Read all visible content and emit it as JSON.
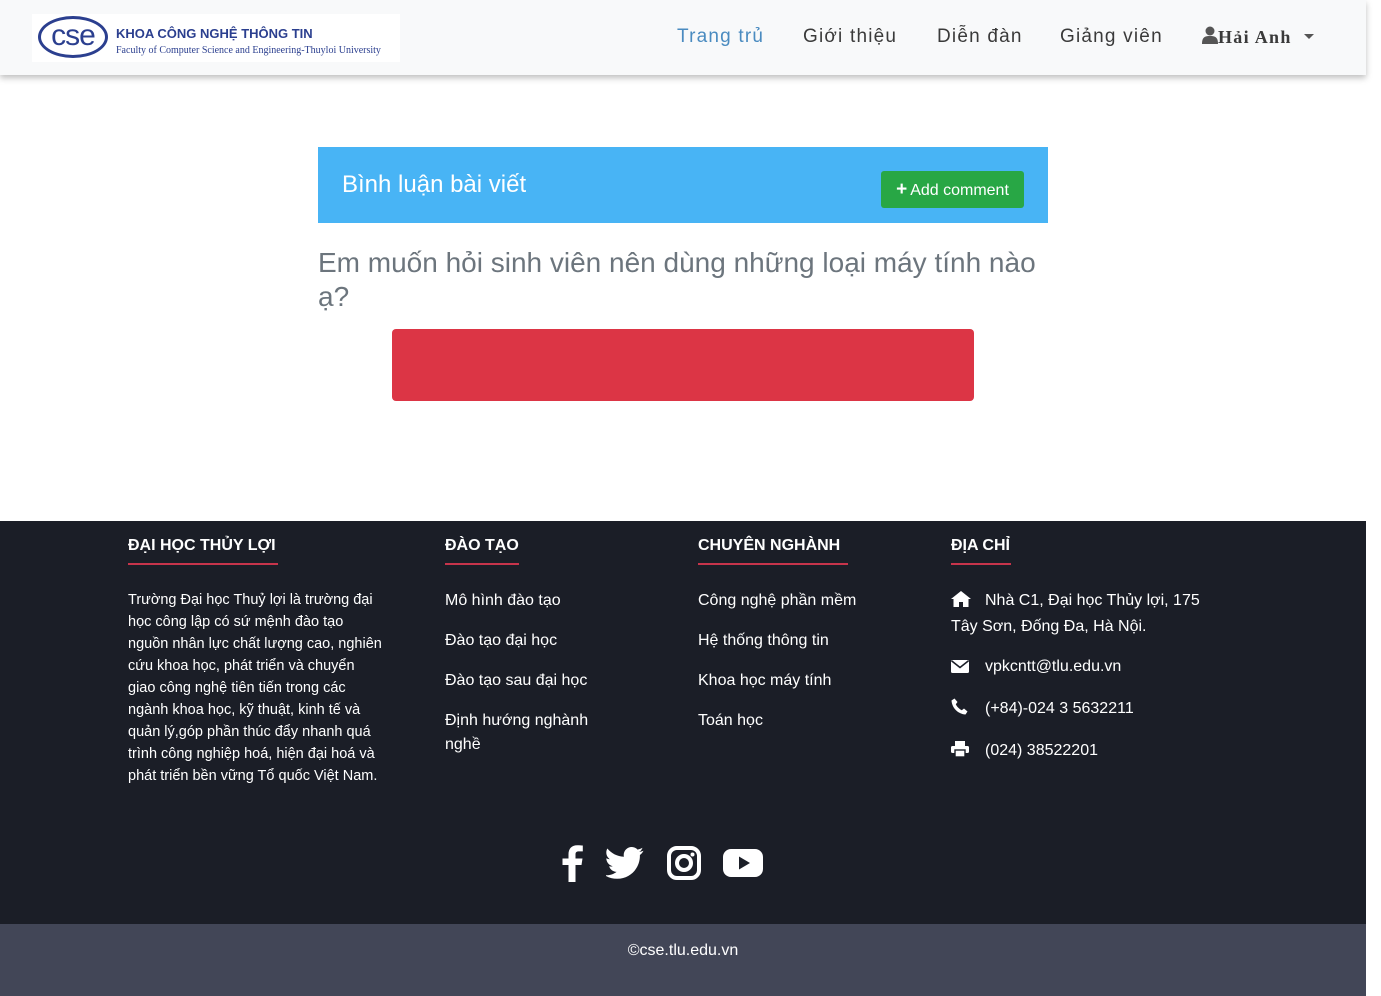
{
  "brand": {
    "logo_mark": "cse",
    "title": "KHOA CÔNG NGHỆ THÔNG TIN",
    "subtitle": "Faculty of Computer Science and Engineering-Thuyloi University"
  },
  "nav": {
    "items": [
      {
        "label": "Trang trủ",
        "active": true
      },
      {
        "label": "Giới thiệu",
        "active": false
      },
      {
        "label": "Diễn đàn",
        "active": false
      },
      {
        "label": "Giảng viên",
        "active": false
      }
    ],
    "user": {
      "name": "Hải Anh",
      "icon": "user-icon"
    }
  },
  "comments": {
    "header_title": "Bình luận bài viết",
    "add_button_label": "Add comment",
    "question": "Em muốn hỏi sinh viên nên dùng những loại máy tính nào ạ?"
  },
  "footer": {
    "university": {
      "heading": "ĐẠI HỌC THỦY LỢI",
      "text": "Trường Đại học Thuỷ lợi là trường đại học công lập có sứ mệnh đào tạo nguồn nhân lực chất lượng cao, nghiên cứu khoa học, phát triển và chuyển giao công nghệ tiên tiến trong các ngành khoa học, kỹ thuật, kinh tế và quản lý,góp phần thúc đẩy nhanh quá trình công nghiệp hoá, hiện đại hoá và phát triển bền vững Tổ quốc Việt Nam."
    },
    "training": {
      "heading": "ĐÀO TẠO",
      "links": [
        "Mô hình đào tạo",
        "Đào tạo đại học",
        "Đào tạo sau đại học",
        "Định hướng nghành nghề"
      ]
    },
    "majors": {
      "heading": "CHUYÊN NGHÀNH",
      "links": [
        "Công nghệ phần mềm",
        "Hệ thống thông tin",
        "Khoa học máy tính",
        "Toán học"
      ]
    },
    "address": {
      "heading": "ĐỊA CHỈ",
      "location": "Nhà C1, Đại học Thủy lợi, 175 Tây Sơn, Đống Đa, Hà Nội.",
      "email": "vpkcntt@tlu.edu.vn",
      "phone": "(+84)-024 3 5632211",
      "fax": "(024) 38522201"
    },
    "social_icons": [
      "facebook-icon",
      "twitter-icon",
      "instagram-icon",
      "youtube-icon"
    ],
    "copyright": "©cse.tlu.edu.vn"
  }
}
